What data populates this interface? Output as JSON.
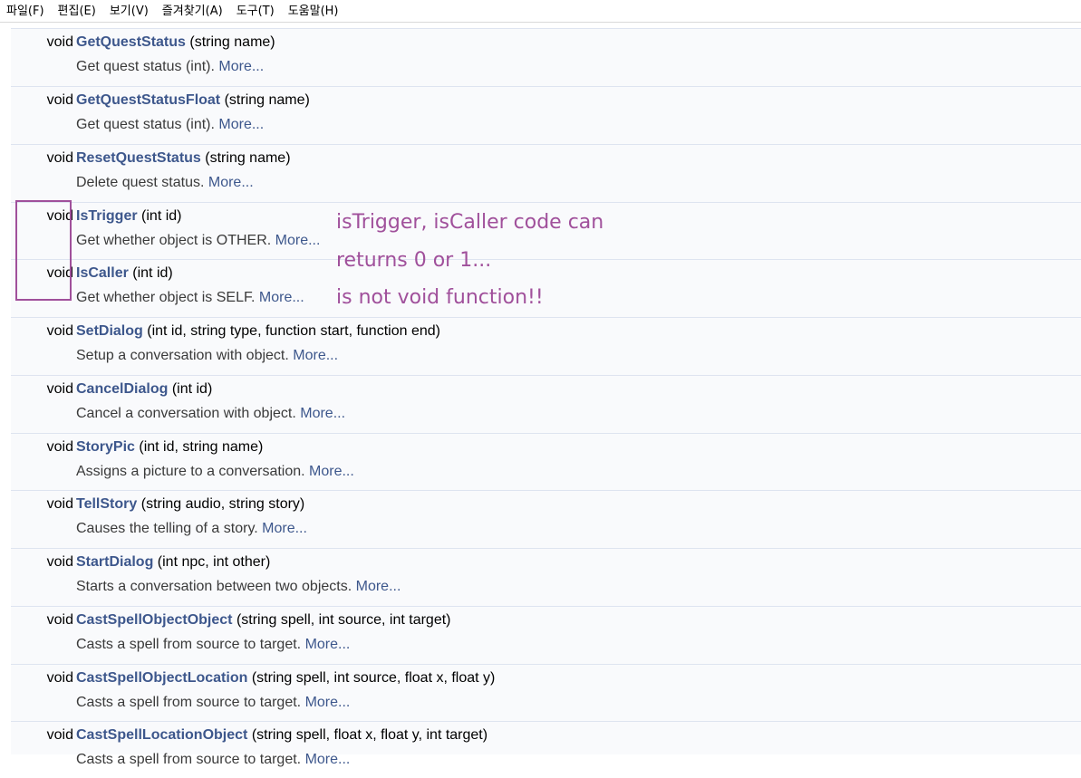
{
  "menubar": {
    "items": [
      {
        "label": "파일(F)"
      },
      {
        "label": "편집(E)"
      },
      {
        "label": "보기(V)"
      },
      {
        "label": "즐겨찾기(A)"
      },
      {
        "label": "도구(T)"
      },
      {
        "label": "도움말(H)"
      }
    ]
  },
  "members": [
    {
      "ret": "void",
      "name": "GetQuestStatus",
      "params": "(string name)",
      "desc": "Get quest status (int).",
      "more": "More..."
    },
    {
      "ret": "void",
      "name": "GetQuestStatusFloat",
      "params": "(string name)",
      "desc": "Get quest status (int).",
      "more": "More..."
    },
    {
      "ret": "void",
      "name": "ResetQuestStatus",
      "params": "(string name)",
      "desc": "Delete quest status.",
      "more": "More..."
    },
    {
      "ret": "void",
      "name": "IsTrigger",
      "params": "(int id)",
      "desc": "Get whether object is OTHER.",
      "more": "More..."
    },
    {
      "ret": "void",
      "name": "IsCaller",
      "params": "(int id)",
      "desc": "Get whether object is SELF.",
      "more": "More..."
    },
    {
      "ret": "void",
      "name": "SetDialog",
      "params": "(int id, string type, function start, function end)",
      "desc": "Setup a conversation with object.",
      "more": "More..."
    },
    {
      "ret": "void",
      "name": "CancelDialog",
      "params": "(int id)",
      "desc": "Cancel a conversation with object.",
      "more": "More..."
    },
    {
      "ret": "void",
      "name": "StoryPic",
      "params": "(int id, string name)",
      "desc": "Assigns a picture to a conversation.",
      "more": "More..."
    },
    {
      "ret": "void",
      "name": "TellStory",
      "params": "(string audio, string story)",
      "desc": "Causes the telling of a story.",
      "more": "More..."
    },
    {
      "ret": "void",
      "name": "StartDialog",
      "params": "(int npc, int other)",
      "desc": "Starts a conversation between two objects.",
      "more": "More..."
    },
    {
      "ret": "void",
      "name": "CastSpellObjectObject",
      "params": "(string spell, int source, int target)",
      "desc": "Casts a spell from source to target.",
      "more": "More..."
    },
    {
      "ret": "void",
      "name": "CastSpellObjectLocation",
      "params": "(string spell, int source, float x, float y)",
      "desc": "Casts a spell from source to target.",
      "more": "More..."
    },
    {
      "ret": "void",
      "name": "CastSpellLocationObject",
      "params": "(string spell, float x, float y, int target)",
      "desc": "Casts a spell from source to target.",
      "more": "More..."
    }
  ],
  "annotation": {
    "lines": [
      "isTrigger, isCaller code can",
      "returns 0 or 1...",
      "is not void function!!"
    ],
    "color": "#a0509b"
  },
  "colors": {
    "link": "#3d578c",
    "row_bg": "#f9fafc",
    "separator": "#dee4f0"
  }
}
